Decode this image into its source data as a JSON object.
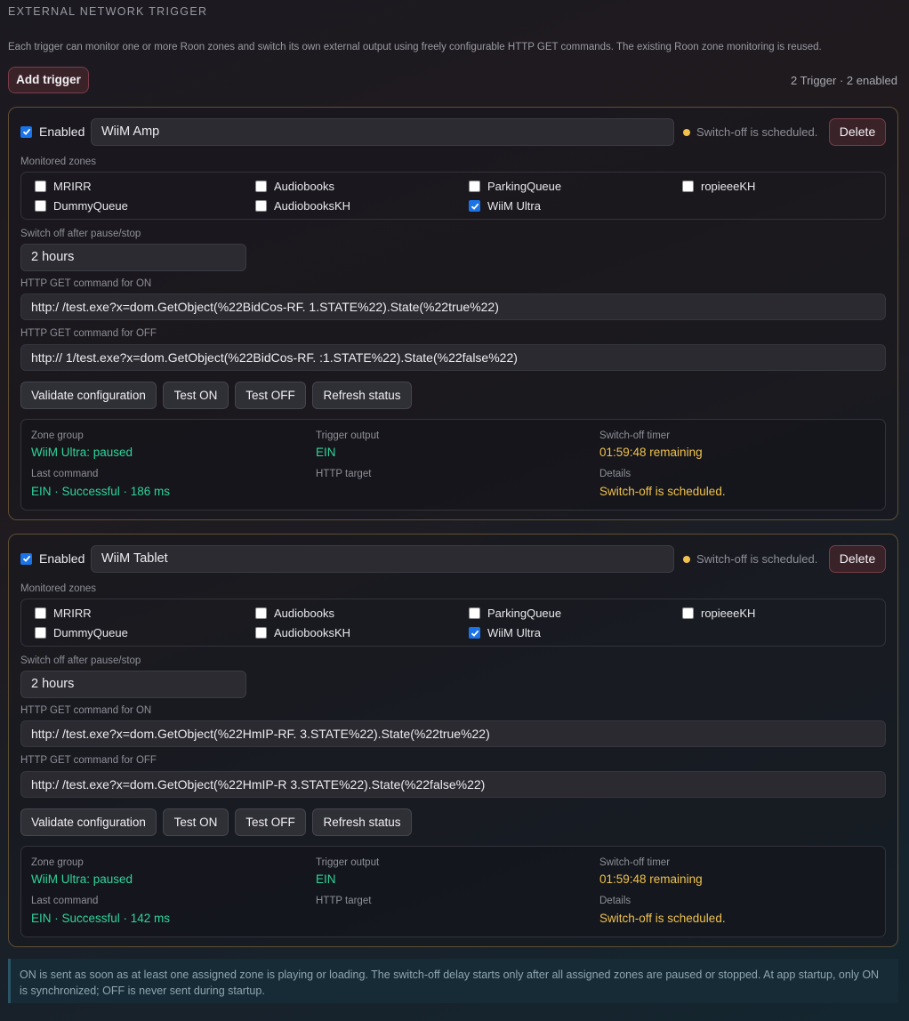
{
  "header": {
    "title": "EXTERNAL NETWORK TRIGGER",
    "intro": "Each trigger can monitor one or more Roon zones and switch its own external output using freely configurable HTTP GET commands. The existing Roon zone monitoring is reused.",
    "add_label": "Add trigger",
    "count": "2 Trigger · 2 enabled"
  },
  "labels": {
    "enabled": "Enabled",
    "monitored_zones": "Monitored zones",
    "switch_off_after": "Switch off after pause/stop",
    "http_on": "HTTP GET command for ON",
    "http_off": "HTTP GET command for OFF",
    "validate": "Validate configuration",
    "test_on": "Test ON",
    "test_off": "Test OFF",
    "refresh": "Refresh status",
    "delete": "Delete",
    "zone_group": "Zone group",
    "trigger_output": "Trigger output",
    "switch_off_timer": "Switch-off timer",
    "last_command": "Last command",
    "http_target": "HTTP target",
    "details": "Details"
  },
  "colors": {
    "accent_green": "#2fd49a",
    "accent_yellow": "#f0c24d",
    "danger_border": "#7a3c48",
    "card_border": "#5e4f33"
  },
  "triggers": [
    {
      "enabled": true,
      "name": "WiiM Amp",
      "status": "Switch-off is scheduled.",
      "zones": [
        {
          "name": "MRIRR",
          "checked": false
        },
        {
          "name": "Audiobooks",
          "checked": false
        },
        {
          "name": "ParkingQueue",
          "checked": false
        },
        {
          "name": "ropieeeKH",
          "checked": false
        },
        {
          "name": "DummyQueue",
          "checked": false
        },
        {
          "name": "AudiobooksKH",
          "checked": false
        },
        {
          "name": "WiiM Ultra",
          "checked": true
        }
      ],
      "switch_off_after": "2 hours",
      "url_on": "http:/                    /test.exe?x=dom.GetObject(%22BidCos-RF.              1.STATE%22).State(%22true%22)",
      "url_off": "http://                     1/test.exe?x=dom.GetObject(%22BidCos-RF.              :1.STATE%22).State(%22false%22)",
      "zone_group": "WiiM Ultra: paused",
      "trigger_output": "EIN",
      "switch_off_timer": "01:59:48 remaining",
      "last_command": "EIN · Successful · 186 ms",
      "http_target": "",
      "details": "Switch-off is scheduled."
    },
    {
      "enabled": true,
      "name": "WiiM Tablet",
      "status": "Switch-off is scheduled.",
      "zones": [
        {
          "name": "MRIRR",
          "checked": false
        },
        {
          "name": "Audiobooks",
          "checked": false
        },
        {
          "name": "ParkingQueue",
          "checked": false
        },
        {
          "name": "ropieeeKH",
          "checked": false
        },
        {
          "name": "DummyQueue",
          "checked": false
        },
        {
          "name": "AudiobooksKH",
          "checked": false
        },
        {
          "name": "WiiM Ultra",
          "checked": true
        }
      ],
      "switch_off_after": "2 hours",
      "url_on": "http:/                      /test.exe?x=dom.GetObject(%22HmIP-RF.                  3.STATE%22).State(%22true%22)",
      "url_off": "http:/                      /test.exe?x=dom.GetObject(%22HmIP-R                   3.STATE%22).State(%22false%22)",
      "zone_group": "WiiM Ultra: paused",
      "trigger_output": "EIN",
      "switch_off_timer": "01:59:48 remaining",
      "last_command": "EIN · Successful · 142 ms",
      "http_target": "",
      "details": "Switch-off is scheduled."
    }
  ],
  "footer_note": "ON is sent as soon as at least one assigned zone is playing or loading. The switch-off delay starts only after all assigned zones are paused or stopped. At app startup, only ON is synchronized; OFF is never sent during startup."
}
